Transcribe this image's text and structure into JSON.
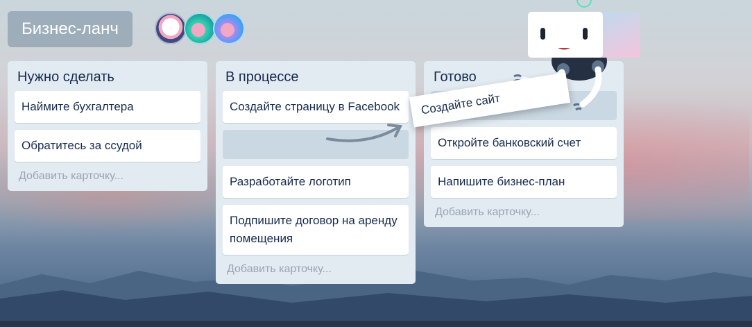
{
  "board": {
    "title": "Бизнес-ланч",
    "members": [
      "member-1",
      "member-2",
      "member-3"
    ]
  },
  "lists": [
    {
      "title": "Нужно сделать",
      "cards": [
        "Наймите бухгалтера",
        "Обратитесь за ссудой"
      ],
      "add": "Добавить карточку..."
    },
    {
      "title": "В процессе",
      "cards": [
        "Создайте страницу в Facebook",
        "Разработайте логотип",
        "Подпишите договор на аренду помещения"
      ],
      "add": "Добавить карточку..."
    },
    {
      "title": "Готово",
      "cards": [
        "Откройте банковский счет",
        "Напишите бизнес-план"
      ],
      "add": "Добавить карточку..."
    }
  ],
  "dragging_card": "Создайте сайт"
}
